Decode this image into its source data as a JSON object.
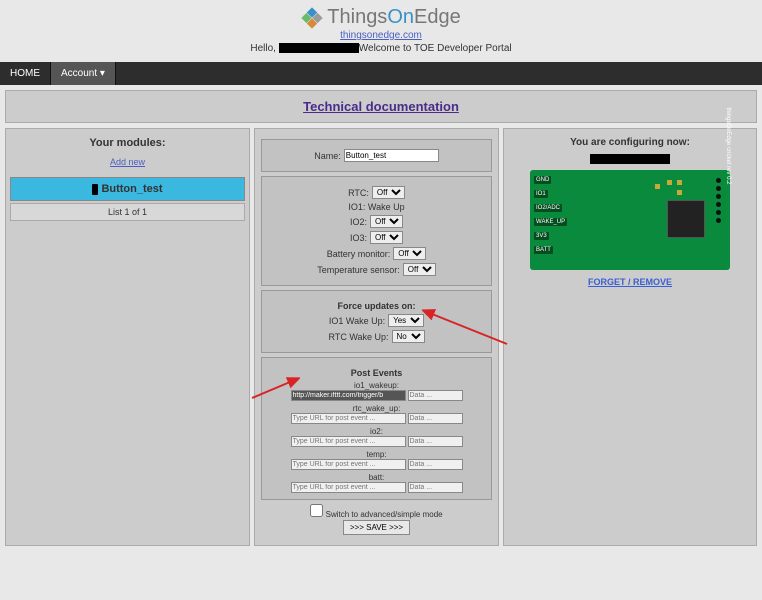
{
  "header": {
    "brand1": "Things",
    "brand2": "On",
    "brand3": "Edge",
    "site_link": "thingsonedge.com",
    "hello_prefix": "Hello, ",
    "hello_suffix": "Welcome to TOE Developer Portal"
  },
  "nav": {
    "home": "HOME",
    "account": "Account ▾"
  },
  "docbar": {
    "label": "Technical documentation"
  },
  "modules": {
    "title": "Your modules:",
    "add_new": "Add new",
    "selected": "Button_test",
    "list_info": "List 1 of 1"
  },
  "form": {
    "name_label": "Name:",
    "name_value": "Button_test",
    "rtc_label": "RTC:",
    "rtc_value": "Off",
    "io1_wake": "IO1: Wake Up",
    "io2_label": "IO2:",
    "io2_value": "Off",
    "io3_label": "IO3:",
    "io3_value": "Off",
    "batt_label": "Battery monitor:",
    "batt_value": "Off",
    "temp_label": "Temperature sensor:",
    "temp_value": "Off",
    "force_title": "Force updates on:",
    "io1w_label": "IO1 Wake Up:",
    "io1w_value": "Yes",
    "rtcw_label": "RTC Wake Up:",
    "rtcw_value": "No",
    "post_title": "Post Events",
    "events": {
      "io1_wakeup": {
        "label": "io1_wakeup:",
        "url": "http://maker.ifttt.com/trigger/b",
        "data": "Data ..."
      },
      "rtc_wake_up": {
        "label": "rtc_wake_up:",
        "url": "Type URL for post event ...",
        "data": "Data ..."
      },
      "io2": {
        "label": "io2:",
        "url": "Type URL for post event ...",
        "data": "Data ..."
      },
      "temp": {
        "label": "temp:",
        "url": "Type URL for post event ...",
        "data": "Data ..."
      },
      "batt": {
        "label": "batt:",
        "url": "Type URL for post event ...",
        "data": "Data ..."
      }
    },
    "switch_label": "Switch to advanced/simple mode",
    "save_label": ">>> SAVE >>>"
  },
  "right": {
    "title": "You are configuring now:",
    "pins": [
      "GND",
      "IO1",
      "IO2/ADC",
      "WAKE_UP",
      "3V3",
      "BATT"
    ],
    "board_name": "cricket rev 0.2",
    "brand": "thingsOnEdge",
    "forget": "FORGET / REMOVE"
  }
}
